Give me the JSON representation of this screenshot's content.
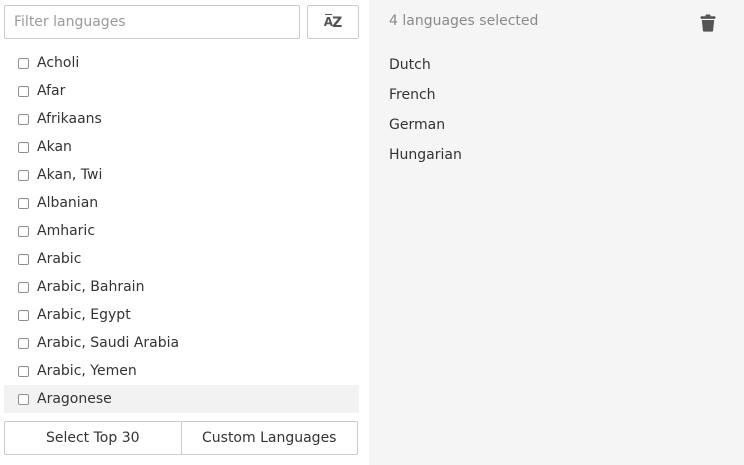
{
  "filter": {
    "placeholder": "Filter languages",
    "value": ""
  },
  "sort_button": {
    "icon": "sort-alpha-icon",
    "label_a": "A",
    "label_z": "Z"
  },
  "languages": [
    {
      "label": "Acholi",
      "checked": false
    },
    {
      "label": "Afar",
      "checked": false
    },
    {
      "label": "Afrikaans",
      "checked": false
    },
    {
      "label": "Akan",
      "checked": false
    },
    {
      "label": "Akan, Twi",
      "checked": false
    },
    {
      "label": "Albanian",
      "checked": false
    },
    {
      "label": "Amharic",
      "checked": false
    },
    {
      "label": "Arabic",
      "checked": false
    },
    {
      "label": "Arabic, Bahrain",
      "checked": false
    },
    {
      "label": "Arabic, Egypt",
      "checked": false
    },
    {
      "label": "Arabic, Saudi Arabia",
      "checked": false
    },
    {
      "label": "Arabic, Yemen",
      "checked": false
    },
    {
      "label": "Aragonese",
      "checked": false
    }
  ],
  "buttons": {
    "select_top": "Select Top 30",
    "custom": "Custom Languages"
  },
  "selected_panel": {
    "count_text": "4 languages selected",
    "clear_icon": "trash-icon",
    "items": [
      "Dutch",
      "French",
      "German",
      "Hungarian"
    ]
  },
  "colors": {
    "right_panel_bg": "#f5f5f5",
    "hover_row_bg": "#f2f2f2",
    "muted_text": "#8a8a8a"
  }
}
